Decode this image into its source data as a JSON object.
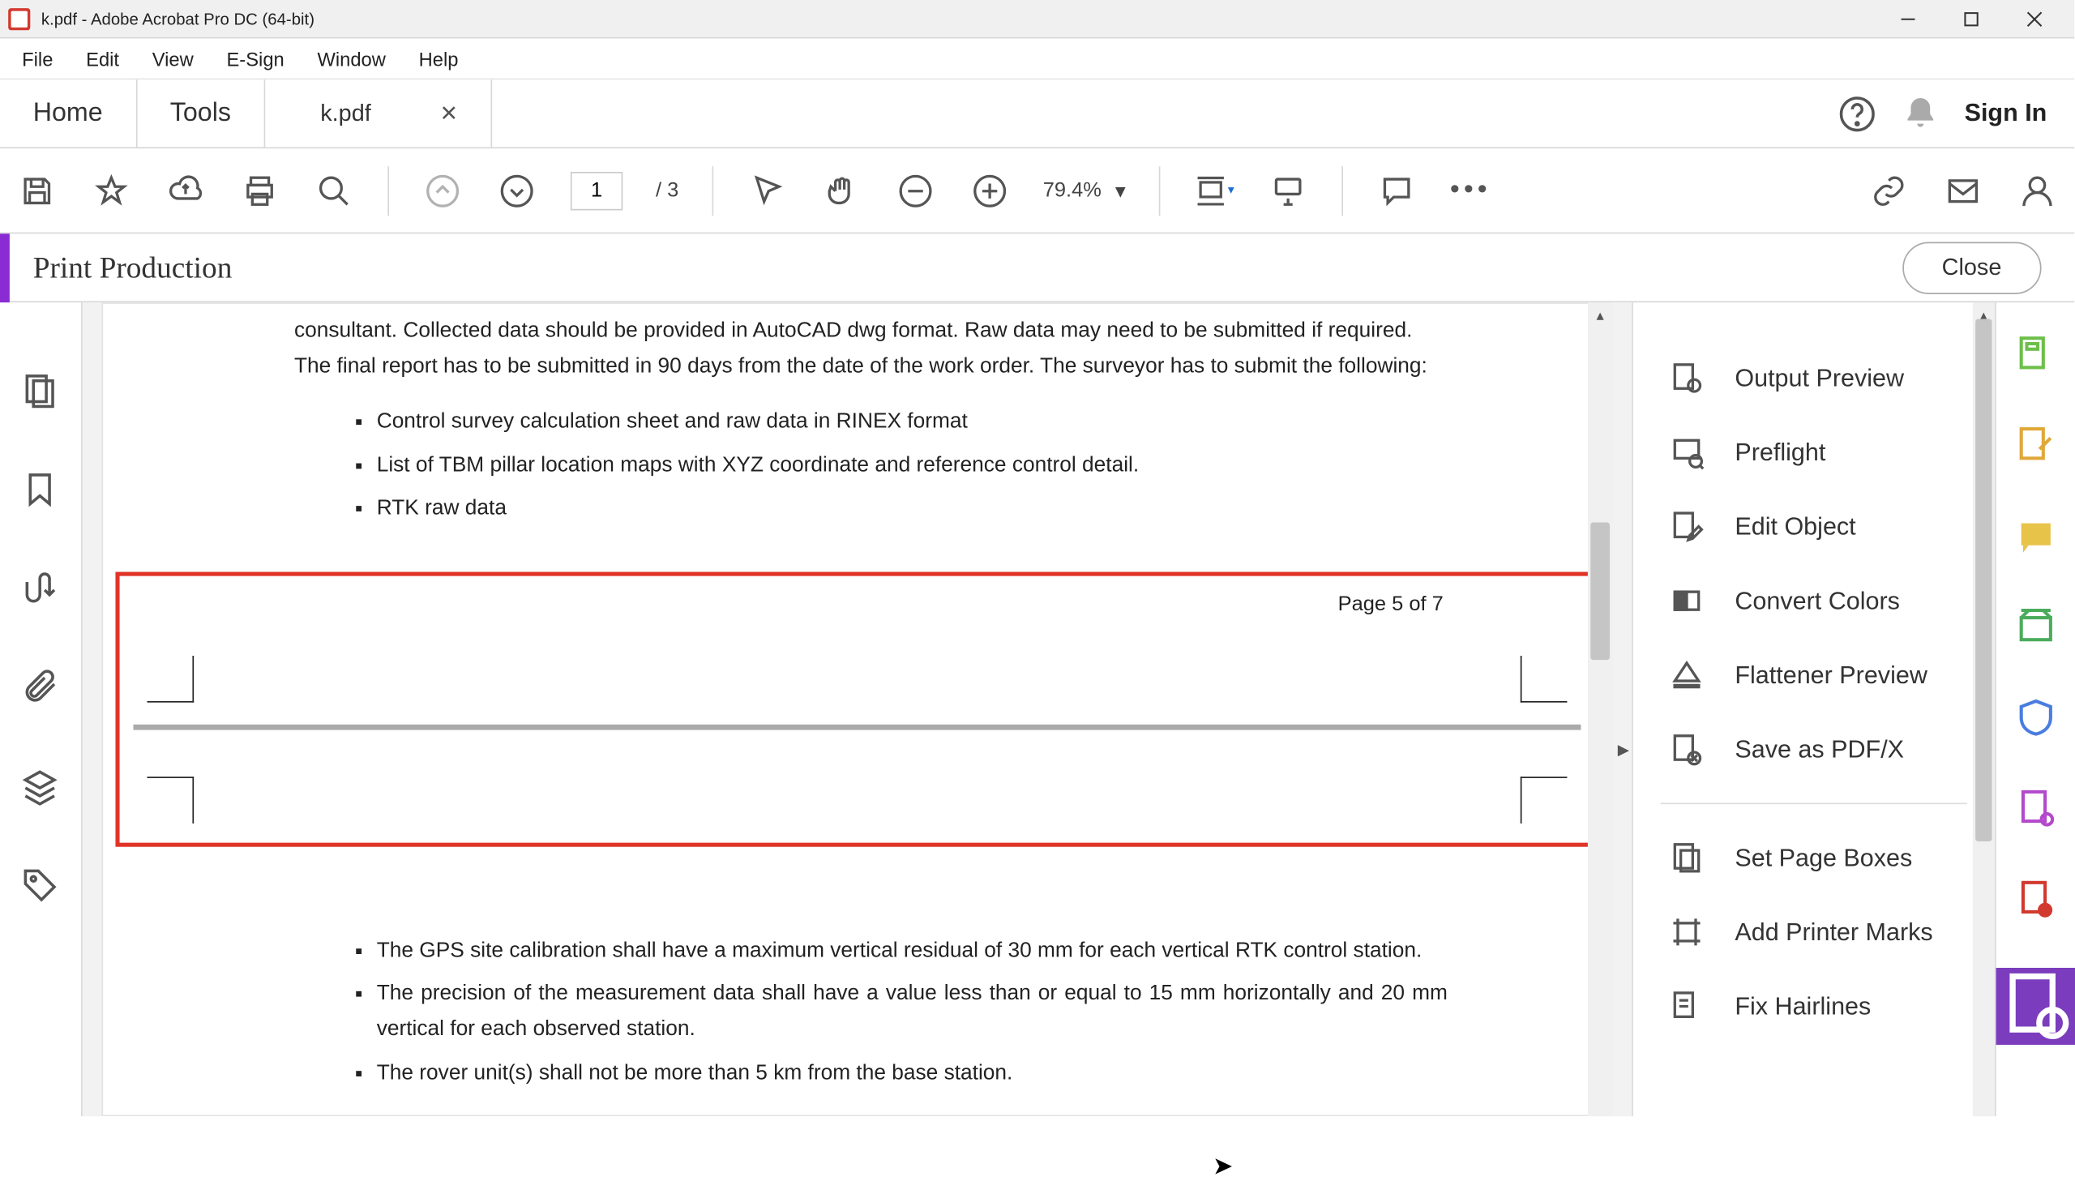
{
  "window": {
    "title": "k.pdf - Adobe Acrobat Pro DC (64-bit)"
  },
  "menu": {
    "items": [
      "File",
      "Edit",
      "View",
      "E-Sign",
      "Window",
      "Help"
    ]
  },
  "tabs": {
    "home": "Home",
    "tools": "Tools",
    "doc": "k.pdf"
  },
  "rightTop": {
    "signIn": "Sign In"
  },
  "toolbar": {
    "pageCurrent": "1",
    "pageTotal": "/ 3",
    "zoom": "79.4%"
  },
  "panelbar": {
    "title": "Print Production",
    "close": "Close"
  },
  "document": {
    "intro": "consultant. Collected data should be provided in AutoCAD dwg format. Raw data may need to be submitted if required. The final report has to be submitted in 90 days from the date of the work order. The surveyor has to submit the following:",
    "bullets1": [
      "Control survey calculation sheet and raw data in RINEX format",
      "List of TBM pillar location maps with XYZ coordinate and reference control detail.",
      "RTK raw data"
    ],
    "pageIndicator": "Page 5 of 7",
    "bullets2": [
      "The GPS site calibration shall have a maximum vertical residual of 30 mm for each vertical RTK control station.",
      "The precision of the measurement data shall have a value less than or equal to 15 mm horizontally and 20 mm vertical for each observed station.",
      "The rover unit(s) shall not be more than 5 km from the base station."
    ]
  },
  "tools": {
    "items": [
      "Output Preview",
      "Preflight",
      "Edit Object",
      "Convert Colors",
      "Flattener Preview",
      "Save as PDF/X",
      "Set Page Boxes",
      "Add Printer Marks",
      "Fix Hairlines"
    ]
  }
}
